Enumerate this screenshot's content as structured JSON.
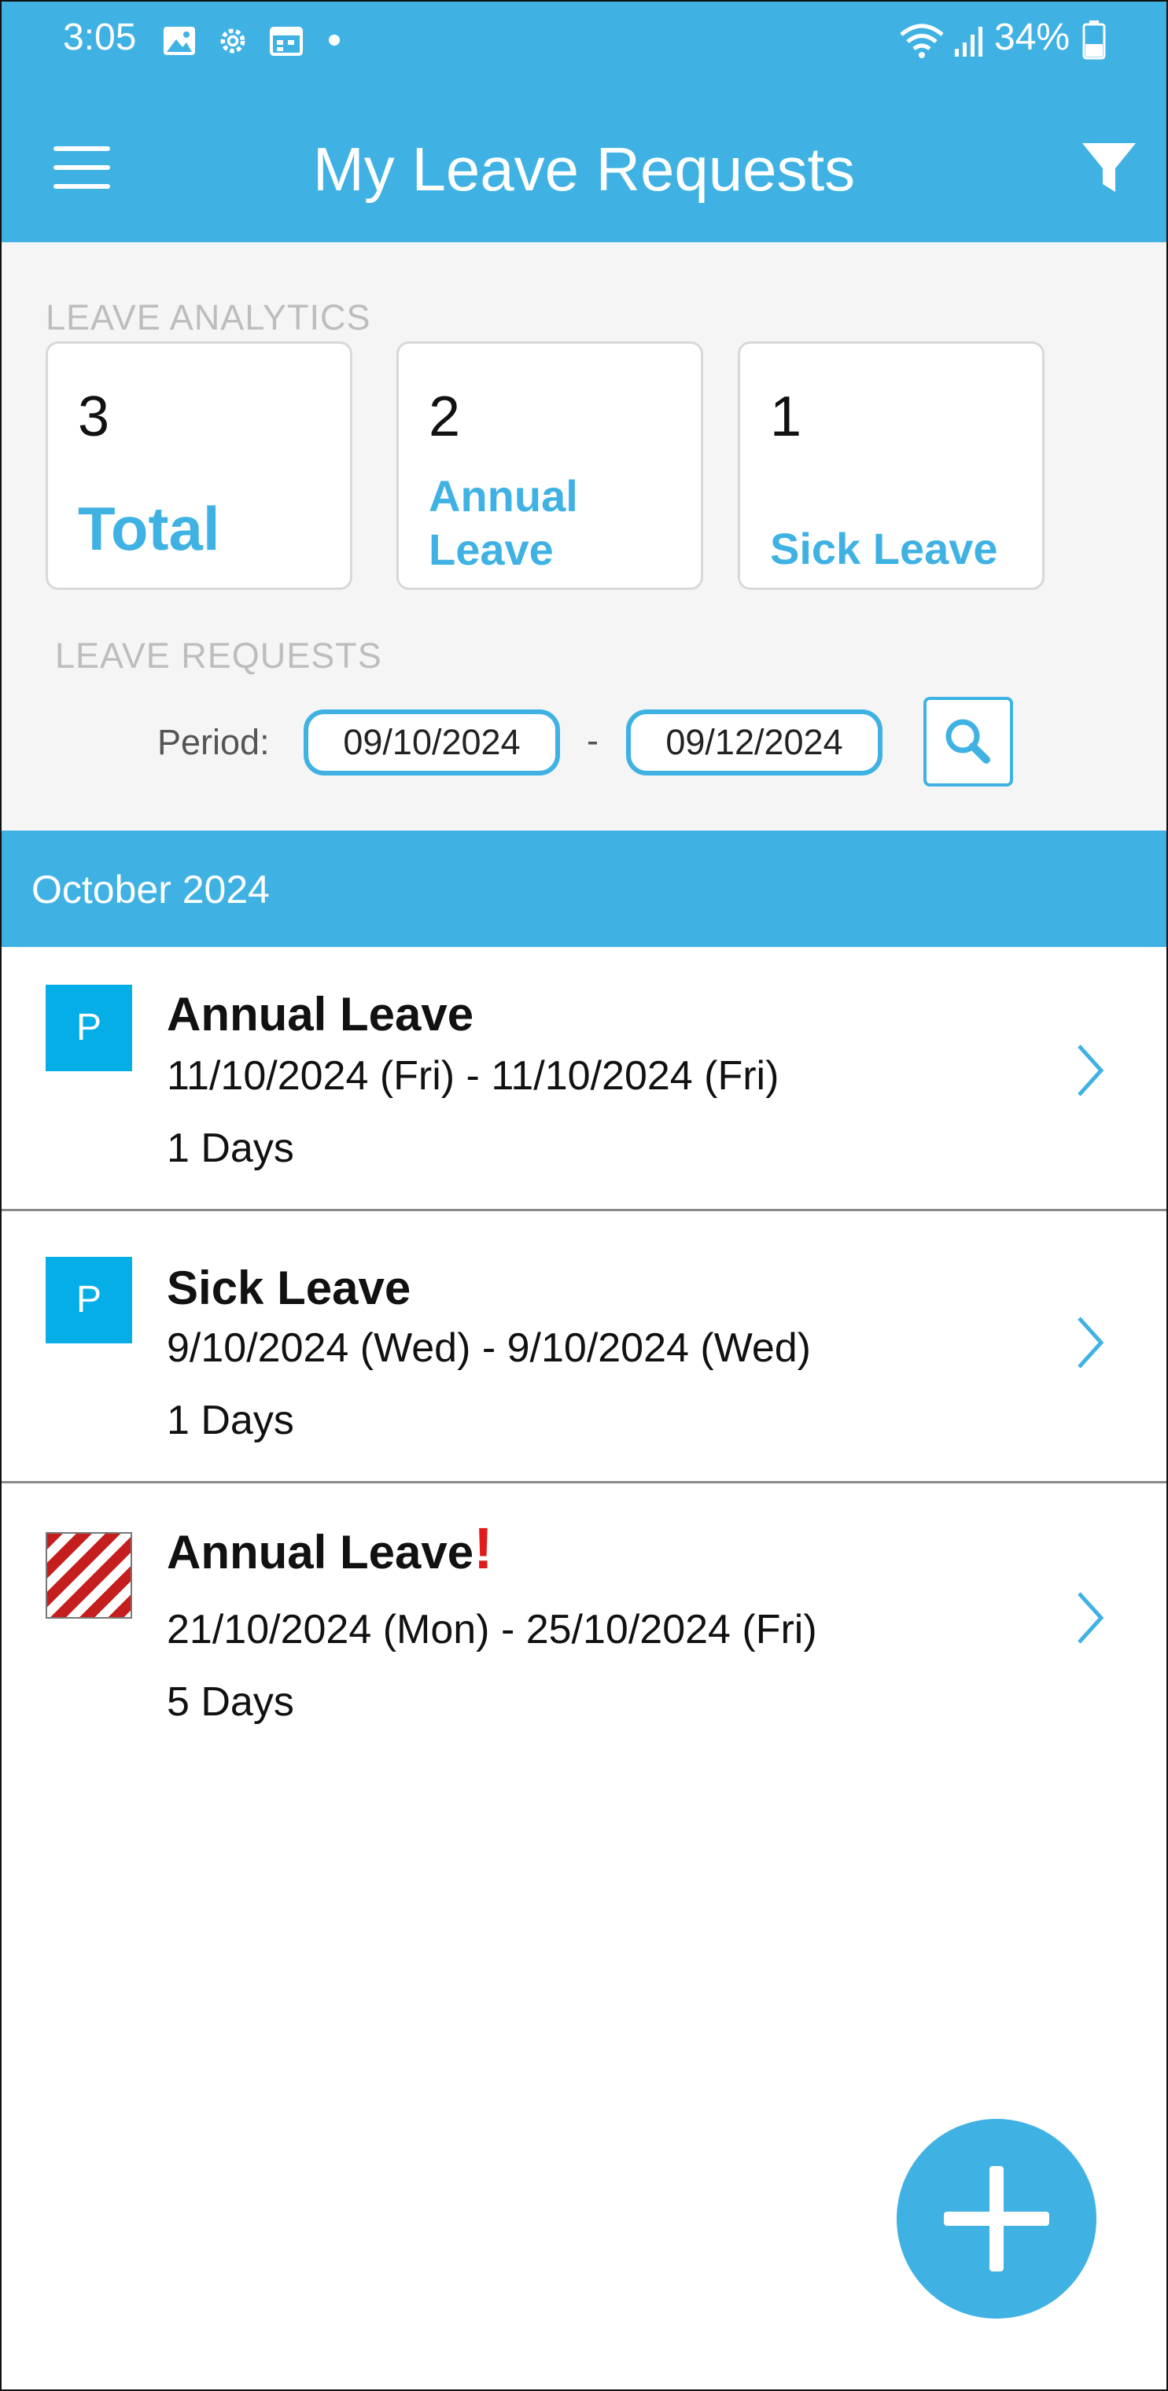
{
  "status_bar": {
    "time": "3:05",
    "battery": "34%",
    "icons": [
      "image-icon",
      "gear-icon",
      "calendar-icon",
      "wifi-icon",
      "signal-icon",
      "battery-icon"
    ]
  },
  "app_bar": {
    "title": "My Leave Requests",
    "menu_icon": "hamburger-menu-icon",
    "filter_icon": "filter-icon"
  },
  "analytics": {
    "section_label": "LEAVE ANALYTICS",
    "cards": [
      {
        "count": "3",
        "label": "Total"
      },
      {
        "count": "2",
        "label": "Annual Leave"
      },
      {
        "count": "1",
        "label": "Sick Leave"
      }
    ]
  },
  "requests": {
    "section_label": "LEAVE REQUESTS",
    "period_label": "Period:",
    "from": "09/10/2024",
    "separator": "-",
    "to": "09/12/2024"
  },
  "month_header": "October 2024",
  "items": [
    {
      "badge": "P",
      "title": "Annual Leave",
      "warning": "",
      "dates": "11/10/2024 (Fri) - 11/10/2024 (Fri)",
      "days": "1 Days"
    },
    {
      "badge": "P",
      "title": "Sick Leave",
      "warning": "",
      "dates": "9/10/2024 (Wed) - 9/10/2024 (Wed)",
      "days": "1 Days"
    },
    {
      "badge": "",
      "title": "Annual Leave",
      "warning": "!",
      "dates": "21/10/2024 (Mon) - 25/10/2024 (Fri)",
      "days": "5 Days"
    }
  ],
  "colors": {
    "primary": "#3fb2e3",
    "badge": "#06aee8",
    "warning": "#e01b1b",
    "stripe": "#c41e1e"
  }
}
